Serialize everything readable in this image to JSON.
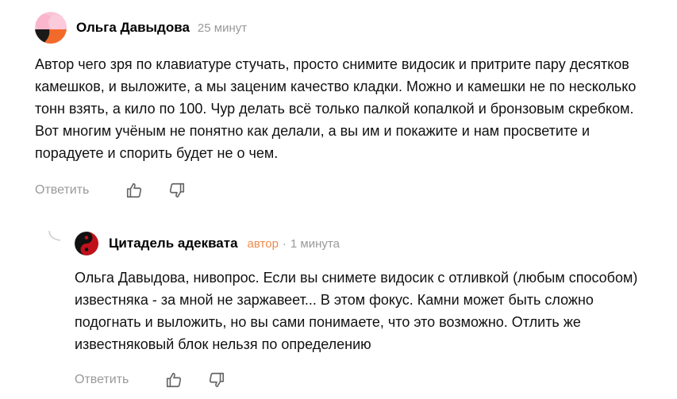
{
  "comments": [
    {
      "author": "Ольга Давыдова",
      "time": "25 минут",
      "text": "Автор чего зря по клавиатуре стучать, просто снимите видосик и притрите пару десятков камешков, и выложите, а мы заценим качество кладки. Можно и камешки не по несколько тонн взять, а кило по 100. Чур делать всё только палкой копалкой и бронзовым скребком. Вот многим учёным не понятно как делали, а вы им и покажите и нам просветите и порадуете и спорить будет не о чем.",
      "reply_label": "Ответить",
      "avatar_icon": "pink-orange-abstract-avatar"
    },
    {
      "author": "Цитадель адеквата",
      "badge": "автор",
      "separator": "·",
      "time": "1 минута",
      "text": "Ольга Давыдова, нивопрос. Если вы снимете видосик с отливкой (любым способом) известняка - за мной не заржавеет... В этом фокус. Камни может быть сложно подогнать и выложить, но вы сами понимаете, что это возможно. Отлить же известняковый блок нельзя по определению",
      "reply_label": "Ответить",
      "avatar_icon": "red-black-yin-yang-avatar"
    }
  ],
  "colors": {
    "muted": "#999999",
    "badge": "#f08a4b",
    "text": "#111111"
  }
}
